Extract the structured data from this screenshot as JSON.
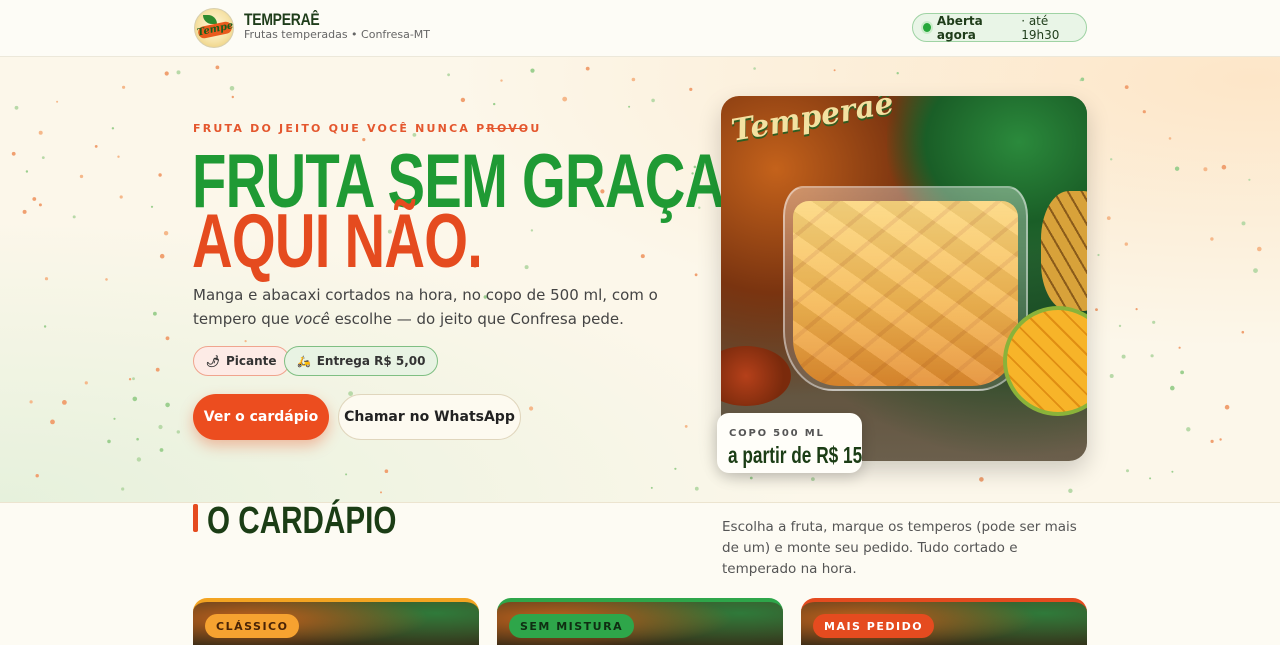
{
  "header": {
    "brand_name": "TEMPERAÊ",
    "brand_sub": "Frutas temperadas • Confresa-MT",
    "logo_text": "Temperaê",
    "status_open": "Aberta agora",
    "status_hours": "· até 19h30",
    "status_color": "#26a83a"
  },
  "hero": {
    "eyebrow": "FRUTA DO JEITO QUE VOCÊ NUNCA PROVOU",
    "headline_line1": "FRUTA SEM GRAÇA?",
    "headline_line2": "AQUI NÃO.",
    "lead_before": "Manga e abacaxi cortados na hora, no copo de 500 ml, com o tempero que ",
    "lead_emphasis": "você",
    "lead_after": " escolhe — do jeito que Confresa pede.",
    "chips": [
      {
        "icon": "chili-icon",
        "glyph": "🌶",
        "label": "Picante"
      },
      {
        "icon": "motorbike-icon",
        "glyph": "🛵",
        "label": "Entrega R$ 5,00"
      }
    ],
    "primary_button": "Ver o cardápio",
    "secondary_button": "Chamar no WhatsApp",
    "photo_label": "Temperaê",
    "price_label": "COPO 500 ML",
    "price_value": "a partir de R$ 15",
    "accent_green": "#1f9a34",
    "accent_orange": "#e54b1f"
  },
  "menu": {
    "title": "O CARDÁPIO",
    "description": "Escolha a fruta, marque os temperos (pode ser mais de um) e monte seu pedido. Tudo cortado e temperado na hora.",
    "cards": [
      {
        "badge": "CLÁSSICO"
      },
      {
        "badge": "SEM MISTURA"
      },
      {
        "badge": "MAIS PEDIDO"
      }
    ]
  }
}
